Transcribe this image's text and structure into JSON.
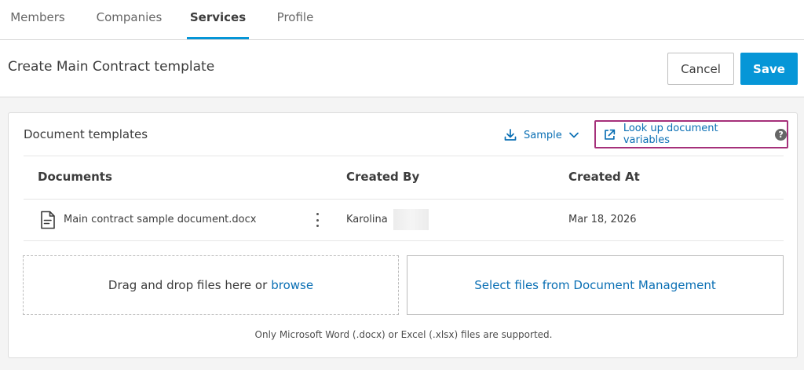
{
  "nav": {
    "tabs": [
      {
        "label": "Members"
      },
      {
        "label": "Companies"
      },
      {
        "label": "Services"
      },
      {
        "label": "Profile"
      }
    ]
  },
  "header": {
    "title": "Create Main Contract template",
    "cancel_label": "Cancel",
    "save_label": "Save"
  },
  "card": {
    "title": "Document templates",
    "sample_label": "Sample",
    "lookup_label": "Look up document variables",
    "help_glyph": "?",
    "columns": {
      "documents": "Documents",
      "created_by": "Created By",
      "created_at": "Created At"
    },
    "rows": [
      {
        "name": "Main contract sample document.docx",
        "created_by": "Karolina",
        "created_at": "Mar 18, 2026"
      }
    ],
    "dropzone_text": "Drag and drop files here or",
    "browse_label": "browse",
    "dm_button_label": "Select files from Document Management",
    "support_note": "Only Microsoft Word (.docx) or Excel (.xlsx) files are supported."
  },
  "colors": {
    "accent": "#0696d7",
    "link": "#0a6fb4",
    "highlight_border": "#a5307a"
  },
  "icons": {
    "download": "download-icon",
    "chevron": "chevron-down-icon",
    "external_link": "external-link-icon",
    "help": "help-icon",
    "document": "document-icon",
    "kebab": "kebab-menu-icon"
  }
}
